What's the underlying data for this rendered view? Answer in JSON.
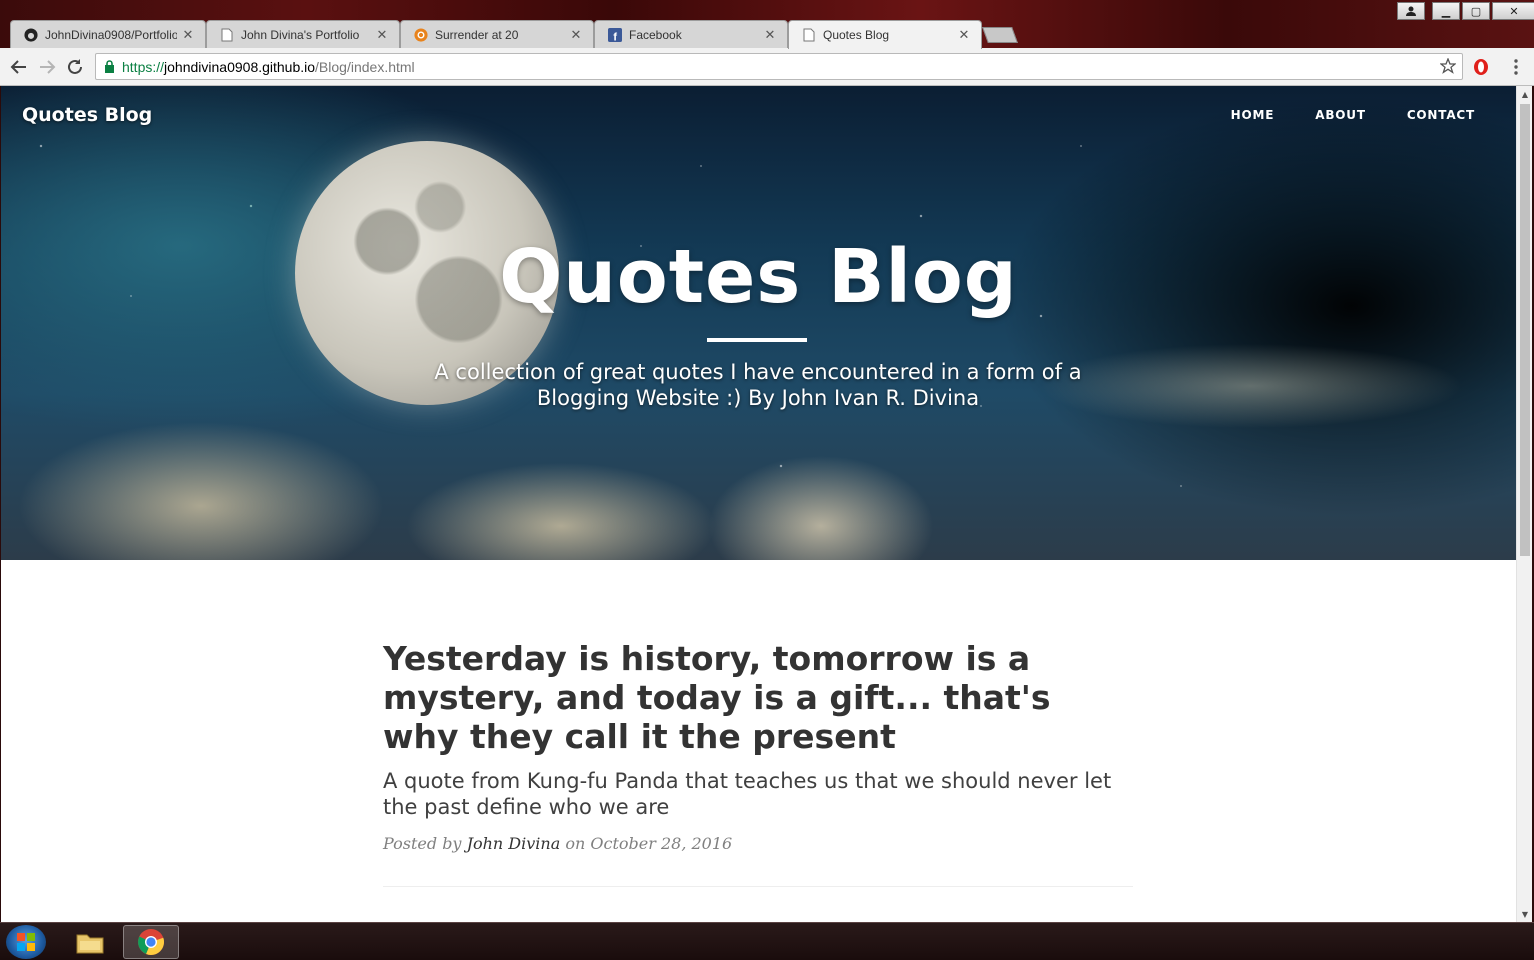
{
  "browser": {
    "tabs": [
      {
        "title": "JohnDivina0908/Portfolio",
        "favicon": "github-icon",
        "active": false
      },
      {
        "title": "John Divina's Portfolio",
        "favicon": "page-icon",
        "active": false
      },
      {
        "title": "Surrender at 20",
        "favicon": "surrender-icon",
        "active": false
      },
      {
        "title": "Facebook",
        "favicon": "facebook-icon",
        "active": false
      },
      {
        "title": "Quotes Blog",
        "favicon": "page-icon",
        "active": true
      }
    ],
    "url": {
      "scheme": "https://",
      "host": "johndivina0908.github.io",
      "path": "/Blog/index.html"
    },
    "secure": true
  },
  "site": {
    "brand": "Quotes Blog",
    "nav": [
      "HOME",
      "ABOUT",
      "CONTACT"
    ],
    "hero": {
      "title": "Quotes Blog",
      "subtitle": "A collection of great quotes I have encountered in a form of a Blogging Website :) By John Ivan R. Divina"
    }
  },
  "post": {
    "title": "Yesterday is history, tomorrow is a mystery, and today is a gift... that's why they call it the present",
    "subtitle": "A quote from Kung-fu Panda that teaches us that we should never let the past define who we are",
    "meta_prefix": "Posted by",
    "author": "John Divina",
    "meta_on": "on",
    "date": "October 28, 2016"
  },
  "colors": {
    "heading": "#333333",
    "meta": "#808080",
    "secure_green": "#0b8043"
  }
}
